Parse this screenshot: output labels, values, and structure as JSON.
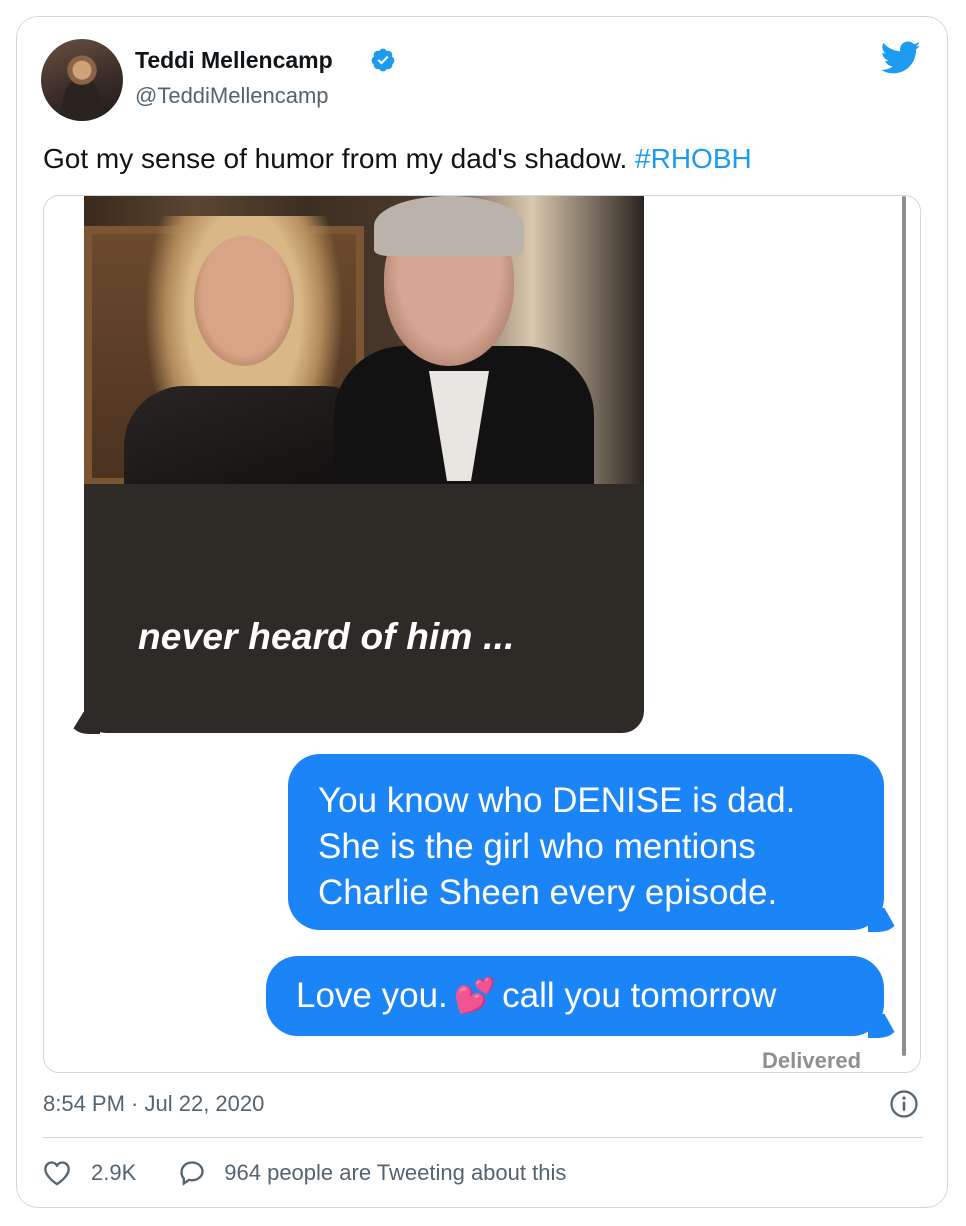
{
  "author": {
    "display_name": "Teddi Mellencamp",
    "handle": "@TeddiMellencamp",
    "verified": true
  },
  "tweet": {
    "text": "Got my sense of humor from my dad's shadow.",
    "hashtag": "#RHOBH",
    "timestamp": "8:54 PM · Jul 22, 2020"
  },
  "media": {
    "photo_caption": "never heard of him ...",
    "message_1": "You know who DENISE is dad. She is the girl who mentions Charlie Sheen every episode.",
    "message_2_before": "Love you.",
    "message_2_emoji": "💕",
    "message_2_after": "call you tomorrow",
    "status": "Delivered"
  },
  "actions": {
    "like_count": "2.9K",
    "conversation_text": "964 people are Tweeting about this"
  },
  "colors": {
    "accent": "#1d9bf0",
    "imessage_blue": "#1b84f6",
    "secondary_text": "#536471"
  },
  "icons": {
    "verified": "verified-badge-icon",
    "logo": "twitter-bird-icon",
    "info": "info-icon",
    "like": "heart-icon",
    "reply": "speech-bubble-icon"
  }
}
